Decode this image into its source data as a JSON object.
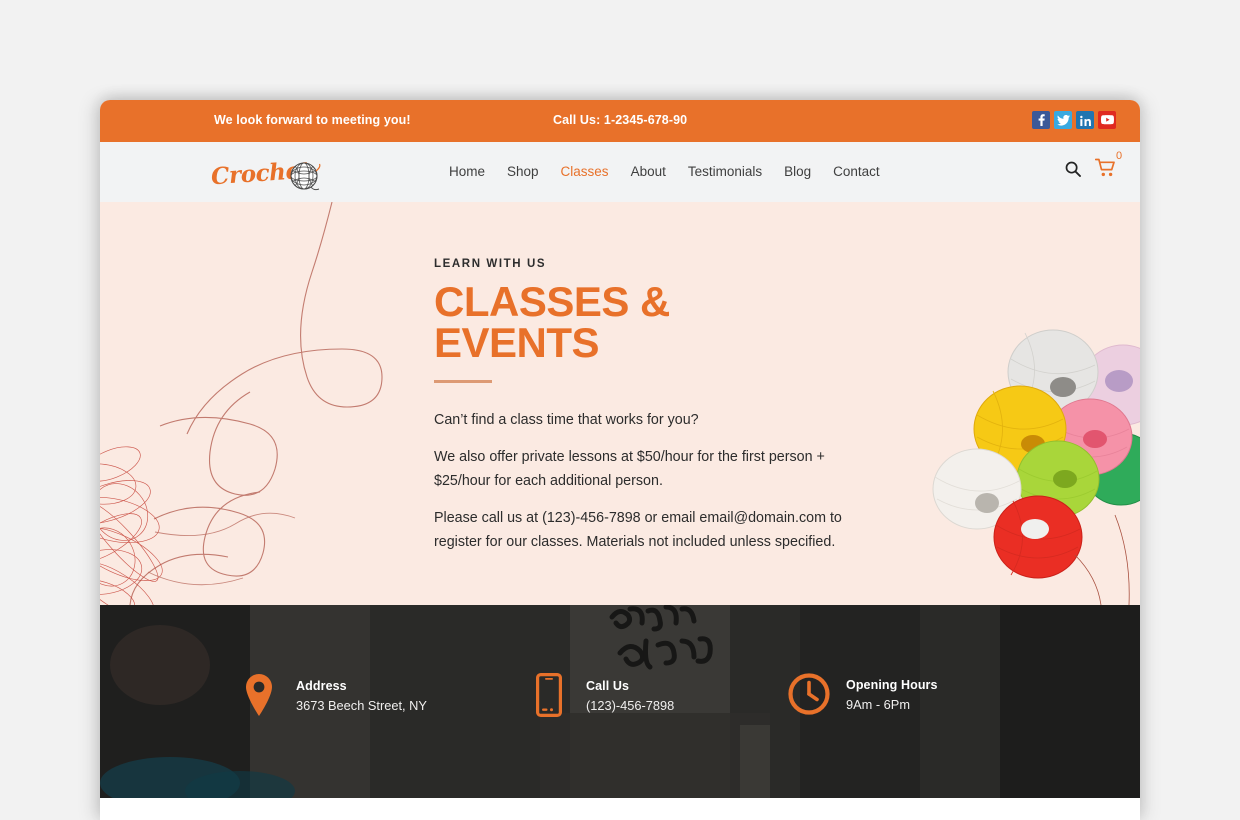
{
  "topbar": {
    "message": "We look forward to meeting you!",
    "phone": "Call Us: 1-2345-678-90",
    "socials": [
      {
        "name": "facebook-icon",
        "label": "Facebook",
        "color": "#3b5998"
      },
      {
        "name": "twitter-icon",
        "label": "Twitter",
        "color": "#3aa9e0"
      },
      {
        "name": "linkedin-icon",
        "label": "LinkedIn",
        "color": "#2175b0"
      },
      {
        "name": "youtube-icon",
        "label": "YouTube",
        "color": "#e02a20"
      }
    ]
  },
  "header": {
    "logo_text": "Crochet",
    "nav": [
      {
        "label": "Home",
        "active": false
      },
      {
        "label": "Shop",
        "active": false
      },
      {
        "label": "Classes",
        "active": true
      },
      {
        "label": "About",
        "active": false
      },
      {
        "label": "Testimonials",
        "active": false
      },
      {
        "label": "Blog",
        "active": false
      },
      {
        "label": "Contact",
        "active": false
      }
    ],
    "search_icon": "search-icon",
    "cart_icon": "shopping-cart-icon",
    "cart_count": "0"
  },
  "hero": {
    "eyebrow": "LEARN WITH US",
    "title_line1": "CLASSES &",
    "title_line2": "EVENTS",
    "paragraph1": "Can’t find a class time that works for you?",
    "paragraph2": "We also offer private lessons at $50/hour for the first person + $25/hour for each additional person.",
    "paragraph3": "Please call us at (123)-456-7898 or email email@domain.com to register for our classes. Materials not included unless specified."
  },
  "info_band": {
    "items": [
      {
        "icon": "map-pin-icon",
        "title": "Address",
        "value": "3673 Beech Street, NY"
      },
      {
        "icon": "mobile-phone-icon",
        "title": "Call Us",
        "value": "(123)-456-7898"
      },
      {
        "icon": "clock-icon",
        "title": "Opening Hours",
        "value": "9Am - 6Pm"
      }
    ]
  },
  "colors": {
    "brand_orange": "#e8712a",
    "hero_background": "#fbeae2",
    "header_background": "#f2f3f4",
    "band_background": "#2a2a28",
    "rule": "#dd9a74"
  }
}
